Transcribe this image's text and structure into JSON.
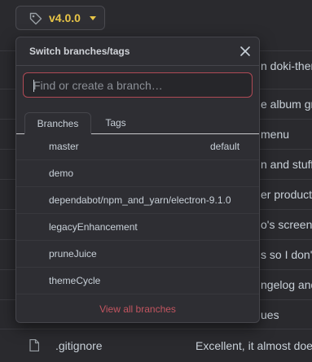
{
  "version_button": {
    "label": "v4.0.0",
    "icon": "tag-icon",
    "caret": "chevron-down-icon"
  },
  "dropdown": {
    "title": "Switch branches/tags",
    "close_icon": "close-icon",
    "search": {
      "placeholder": "Find or create a branch…",
      "value": ""
    },
    "tabs": [
      {
        "label": "Branches",
        "active": true
      },
      {
        "label": "Tags",
        "active": false
      }
    ],
    "branches": [
      {
        "name": "master",
        "badge": "default"
      },
      {
        "name": "demo",
        "badge": ""
      },
      {
        "name": "dependabot/npm_and_yarn/electron-9.1.0",
        "badge": ""
      },
      {
        "name": "legacyEnhancement",
        "badge": ""
      },
      {
        "name": "pruneJuice",
        "badge": ""
      },
      {
        "name": "themeCycle",
        "badge": ""
      }
    ],
    "footer_link": "View all branches"
  },
  "background": {
    "commit_messages": [
      "n doki-them",
      "e album gro",
      "menu",
      "n and stuff",
      "er products",
      "o's screens",
      "s so I don't",
      "ngelog and",
      "ues"
    ],
    "file": {
      "name": ".gitignore",
      "message": "Excellent, it almost doe",
      "icon": "file-icon"
    }
  },
  "colors": {
    "accent": "#e8c547",
    "link": "#c25560",
    "search_border": "#b04a55",
    "background": "#2a2a2e"
  }
}
